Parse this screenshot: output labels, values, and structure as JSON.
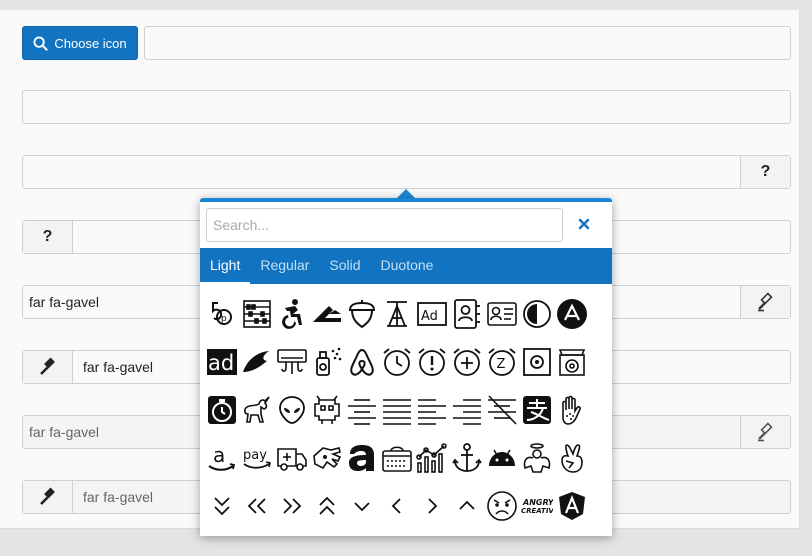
{
  "choose_button": {
    "label": "Choose icon",
    "icon": "search-icon"
  },
  "fields": {
    "row5_value": "far fa-gavel",
    "row6_value": "far fa-gavel",
    "row7_value": "far fa-gavel",
    "row8_value": "far fa-gavel",
    "question_mark": "?"
  },
  "popover": {
    "search_placeholder": "Search...",
    "close_icon": "close-icon",
    "tabs": [
      "Light",
      "Regular",
      "Solid",
      "Duotone"
    ],
    "active_tab": "Light",
    "icons": [
      "500px-icon",
      "abacus-icon",
      "accessible-icon",
      "accusoft-icon",
      "acorn-icon",
      "acquisitions-incorporated-icon",
      "ad-icon",
      "address-book-icon",
      "address-card-icon",
      "adjust-icon",
      "adn-icon",
      "adobe-icon",
      "adversal-icon",
      "air-conditioner-icon",
      "air-freshener-icon",
      "airbnb-icon",
      "alarm-clock-icon",
      "alarm-exclamation-icon",
      "alarm-plus-icon",
      "alarm-snooze-icon",
      "algolia-icon",
      "alicorn-icon",
      "stopwatch-icon",
      "unicorn-icon",
      "alien-icon",
      "alien-monster-icon",
      "align-center-icon",
      "align-justify-icon",
      "align-left-icon",
      "align-right-icon",
      "align-slash-icon",
      "alipay-icon",
      "allergies-icon",
      "amazon-icon",
      "amazon-pay-icon",
      "ambulance-icon",
      "american-sign-language-icon",
      "amilia-icon",
      "amp-guitar-icon",
      "analytics-icon",
      "anchor-icon",
      "android-icon",
      "angel-icon",
      "angellist-icon",
      "angle-double-down-icon",
      "angle-double-left-icon",
      "angle-double-right-icon",
      "angle-double-up-icon",
      "angle-down-icon",
      "angle-left-icon",
      "angle-right-icon",
      "angle-up-icon",
      "angry-icon",
      "angrycreative-icon",
      "angular-icon"
    ],
    "icon_text": {
      "ad": "Ad",
      "adobe": "ad",
      "pay": "pay",
      "amazon": "a",
      "snooze": "Z",
      "angry_line1": "ANGRY",
      "angry_line2": "CREATIVE"
    }
  }
}
